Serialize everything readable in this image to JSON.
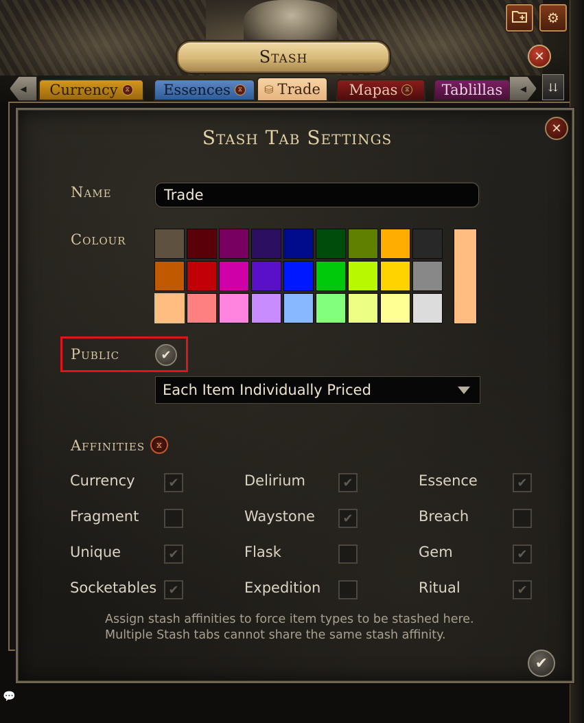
{
  "header": {
    "title": "Stash",
    "new_tab_icon": "folder-plus-icon",
    "settings_icon": "gear-icon",
    "close_glyph": "✕"
  },
  "tabs": [
    {
      "label": "Currency",
      "color": "#d4981a",
      "has_affinity": true
    },
    {
      "label": "Essences",
      "color": "#5d87c3",
      "has_affinity": true
    },
    {
      "label": "Trade",
      "color": "#f7d3a3",
      "active": true
    },
    {
      "label": "Mapas",
      "color": "#8a1d1d",
      "has_affinity": true
    },
    {
      "label": "Tablillas",
      "color": "#7a1f60"
    }
  ],
  "dialog": {
    "title": "Stash Tab Settings",
    "name_label": "Name",
    "name_value": "Trade",
    "colour_label": "Colour",
    "colours": [
      "#5e5140",
      "#5a0008",
      "#780060",
      "#2c0f60",
      "#000c8c",
      "#004c0a",
      "#5f8000",
      "#ffad00",
      "#282828",
      "#c05a00",
      "#c00006",
      "#d000a8",
      "#5a10c8",
      "#0018ff",
      "#00c80a",
      "#b8f800",
      "#ffd300",
      "#888888",
      "#ffbd82",
      "#ff8080",
      "#ff84e0",
      "#c88cff",
      "#88b8ff",
      "#82ff7c",
      "#ecff84",
      "#ffff94",
      "#dcdcdc"
    ],
    "selected_colour": "#ffbd82",
    "public_label": "Public",
    "public_checked": true,
    "pricing_value": "Each Item Individually Priced",
    "affinities_label": "Affinities",
    "affinities": [
      {
        "label": "Currency",
        "checked": true
      },
      {
        "label": "Delirium",
        "checked": true
      },
      {
        "label": "Essence",
        "checked": true
      },
      {
        "label": "Fragment",
        "checked": false
      },
      {
        "label": "Waystone",
        "checked": true
      },
      {
        "label": "Breach",
        "checked": false
      },
      {
        "label": "Unique",
        "checked": true
      },
      {
        "label": "Flask",
        "checked": false
      },
      {
        "label": "Gem",
        "checked": true
      },
      {
        "label": "Socketables",
        "checked": true
      },
      {
        "label": "Expedition",
        "checked": false
      },
      {
        "label": "Ritual",
        "checked": true
      }
    ],
    "help_line1": "Assign stash affinities to force item types to be stashed here.",
    "help_line2": "Multiple Stash tabs cannot share the same stash affinity."
  }
}
